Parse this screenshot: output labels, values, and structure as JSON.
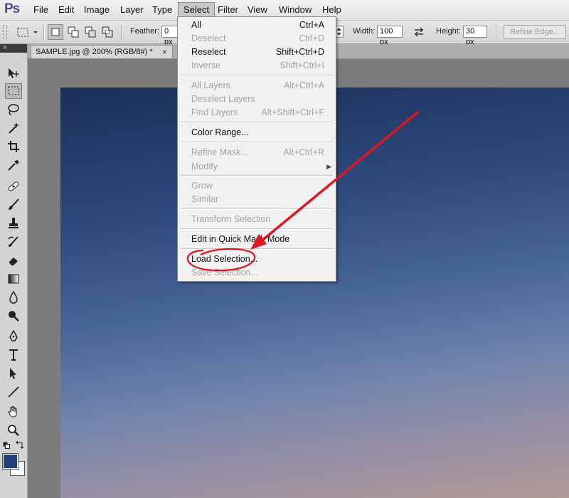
{
  "app": {
    "logo": "Ps"
  },
  "menubar": {
    "items": [
      "File",
      "Edit",
      "Image",
      "Layer",
      "Type",
      "Select",
      "Filter",
      "View",
      "Window",
      "Help"
    ],
    "active": "Select"
  },
  "options": {
    "feather_label": "Feather:",
    "feather_value": "0 px",
    "width_label": "Width:",
    "width_value": "100 px",
    "height_label": "Height:",
    "height_value": "30 px",
    "refine_edge_label": "Refine Edge..."
  },
  "document": {
    "tab_title": "SAMPLE.jpg @ 200% (RGB/8#) *",
    "close_glyph": "×"
  },
  "select_menu": {
    "all": {
      "label": "All",
      "shortcut": "Ctrl+A"
    },
    "deselect": {
      "label": "Deselect",
      "shortcut": "Ctrl+D"
    },
    "reselect": {
      "label": "Reselect",
      "shortcut": "Shift+Ctrl+D"
    },
    "inverse": {
      "label": "Inverse",
      "shortcut": "Shift+Ctrl+I"
    },
    "all_layers": {
      "label": "All Layers",
      "shortcut": "Alt+Ctrl+A"
    },
    "deselect_layers": {
      "label": "Deselect Layers",
      "shortcut": ""
    },
    "find_layers": {
      "label": "Find Layers",
      "shortcut": "Alt+Shift+Ctrl+F"
    },
    "color_range": {
      "label": "Color Range...",
      "shortcut": ""
    },
    "refine_mask": {
      "label": "Refine Mask...",
      "shortcut": "Alt+Ctrl+R"
    },
    "modify": {
      "label": "Modify",
      "shortcut": ""
    },
    "grow": {
      "label": "Grow",
      "shortcut": ""
    },
    "similar": {
      "label": "Similar",
      "shortcut": ""
    },
    "transform_selection": {
      "label": "Transform Selection",
      "shortcut": ""
    },
    "quick_mask": {
      "label": "Edit in Quick Mask Mode",
      "shortcut": ""
    },
    "load_selection": {
      "label": "Load Selection...",
      "shortcut": ""
    },
    "save_selection": {
      "label": "Save Selection...",
      "shortcut": ""
    }
  },
  "colors": {
    "foreground": "#1f3f7e",
    "background": "#ffffff",
    "annotation": "#e0151f"
  },
  "tools": [
    "move-tool-icon",
    "rectangular-marquee-icon",
    "lasso-icon",
    "magic-wand-icon",
    "crop-icon",
    "eyedropper-icon",
    "healing-brush-icon",
    "brush-icon",
    "clone-stamp-icon",
    "history-brush-icon",
    "eraser-icon",
    "gradient-icon",
    "blur-icon",
    "dodge-icon",
    "pen-icon",
    "type-icon",
    "path-selection-icon",
    "line-icon",
    "hand-icon",
    "zoom-icon"
  ]
}
